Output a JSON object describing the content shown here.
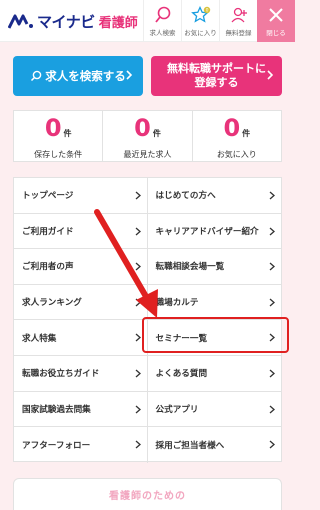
{
  "header": {
    "logo_brand": "マイナビ",
    "logo_sub": "看護師",
    "buttons": [
      {
        "label": "求人検索",
        "icon": "search-icon"
      },
      {
        "label": "お気に入り",
        "icon": "star-icon",
        "badge": "0"
      },
      {
        "label": "無料登録",
        "icon": "user-add-icon"
      },
      {
        "label": "閉じる",
        "icon": "close-icon"
      }
    ]
  },
  "actions": {
    "search_label": "求人を検索する",
    "support_line1": "無料転職サポートに",
    "support_line2": "登録する"
  },
  "stats": [
    {
      "value": "0",
      "unit": "件",
      "label": "保存した条件"
    },
    {
      "value": "0",
      "unit": "件",
      "label": "最近見た求人"
    },
    {
      "value": "0",
      "unit": "件",
      "label": "お気に入り"
    }
  ],
  "nav": [
    {
      "label": "トップページ"
    },
    {
      "label": "はじめての方へ"
    },
    {
      "label": "ご利用ガイド"
    },
    {
      "label": "キャリアアドバイザー紹介"
    },
    {
      "label": "ご利用者の声"
    },
    {
      "label": "転職相談会場一覧"
    },
    {
      "label": "求人ランキング"
    },
    {
      "label": "職場カルテ"
    },
    {
      "label": "求人特集"
    },
    {
      "label": "セミナー一覧"
    },
    {
      "label": "転職お役立ちガイド"
    },
    {
      "label": "よくある質問"
    },
    {
      "label": "国家試験過去問集"
    },
    {
      "label": "公式アプリ"
    },
    {
      "label": "アフターフォロー"
    },
    {
      "label": "採用ご担当者様へ"
    }
  ],
  "bottom": {
    "text": "看護師のための"
  },
  "colors": {
    "brand_blue": "#1a2a8c",
    "search_blue": "#1a9fe0",
    "pink": "#e8337a",
    "highlight_red": "#e02020",
    "background": "#fdeef0"
  }
}
